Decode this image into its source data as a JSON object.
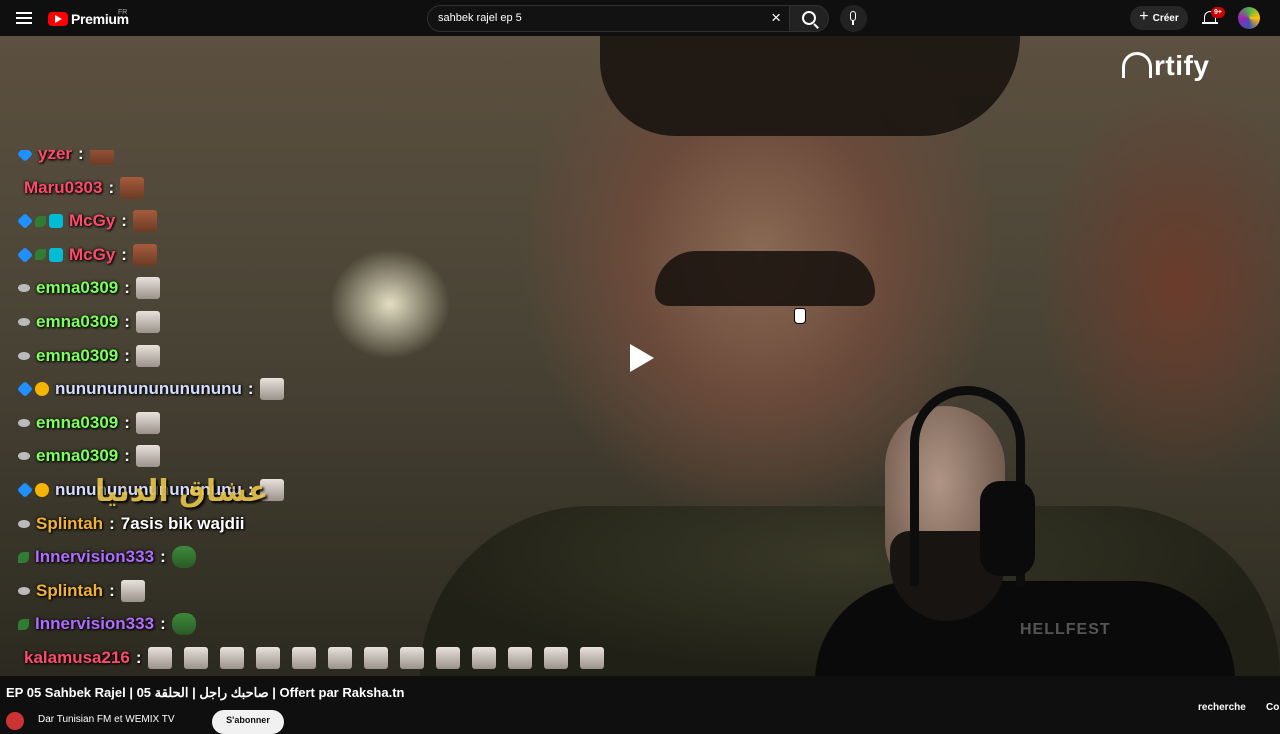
{
  "header": {
    "logo_text": "Premium",
    "region": "FR",
    "search_value": "sahbek rajel ep 5",
    "create_label": "Créer",
    "notif_badge": "9+"
  },
  "video": {
    "watermark": "rtify",
    "overlay_arabic": "عشاق الدنيا"
  },
  "chat": {
    "messages": [
      {
        "user": "yzer",
        "color": "#ff4b6b",
        "text": "",
        "emote": "face"
      },
      {
        "user": "Maru0303",
        "color": "#ff4b6b",
        "text": "",
        "emote": "face"
      },
      {
        "user": "McGy",
        "color": "#ff4b6b",
        "text": "",
        "emote": "face"
      },
      {
        "user": "McGy",
        "color": "#ff4b6b",
        "text": "",
        "emote": "face"
      },
      {
        "user": "emna0309",
        "color": "#7dff5c",
        "text": "",
        "emote": "cat"
      },
      {
        "user": "emna0309",
        "color": "#7dff5c",
        "text": "",
        "emote": "cat"
      },
      {
        "user": "emna0309",
        "color": "#7dff5c",
        "text": "",
        "emote": "cat"
      },
      {
        "user": "nununununununununu",
        "color": "#d6dcff",
        "text": "",
        "emote": "cat"
      },
      {
        "user": "emna0309",
        "color": "#7dff5c",
        "text": "",
        "emote": "cat"
      },
      {
        "user": "emna0309",
        "color": "#7dff5c",
        "text": "",
        "emote": "cat"
      },
      {
        "user": "nununununununununu",
        "color": "#d6dcff",
        "text": "",
        "emote": "cat"
      },
      {
        "user": "Splintah",
        "color": "#f2b233",
        "text": "7asis bik wajdii",
        "emote": ""
      },
      {
        "user": "Innervision333",
        "color": "#b06cff",
        "text": "",
        "emote": "frog"
      },
      {
        "user": "Splintah",
        "color": "#f2b233",
        "text": "",
        "emote": "cat"
      },
      {
        "user": "Innervision333",
        "color": "#b06cff",
        "text": "",
        "emote": "frog"
      },
      {
        "user": "kalamusa216",
        "color": "#ff4b6b",
        "text": "",
        "emote": "cats"
      }
    ]
  },
  "below": {
    "title": "EP 05 Sahbek Rajel | صاحبك راجل | الحلقة 05 | Offert par Raksha.tn",
    "channel_name": "Dar Tunisian FM et WEMIX TV",
    "subscribe_label": "S'abonner",
    "recherche": "recherche",
    "cut": "Co"
  }
}
